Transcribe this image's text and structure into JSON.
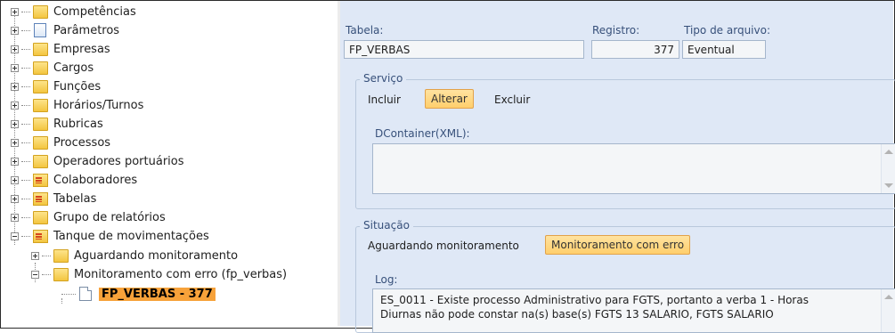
{
  "tree": {
    "items": [
      {
        "label": "Competências",
        "icon": "folder-icon",
        "expander": "plus"
      },
      {
        "label": "Parâmetros",
        "icon": "document-icon",
        "expander": "plus"
      },
      {
        "label": "Empresas",
        "icon": "folder-icon",
        "expander": "plus"
      },
      {
        "label": "Cargos",
        "icon": "folder-icon",
        "expander": "plus"
      },
      {
        "label": "Funções",
        "icon": "folder-icon",
        "expander": "plus"
      },
      {
        "label": "Horários/Turnos",
        "icon": "folder-icon",
        "expander": "plus"
      },
      {
        "label": "Rubricas",
        "icon": "folder-icon",
        "expander": "plus"
      },
      {
        "label": "Processos",
        "icon": "folder-icon",
        "expander": "plus"
      },
      {
        "label": "Operadores portuários",
        "icon": "folder-icon",
        "expander": "plus"
      },
      {
        "label": "Colaboradores",
        "icon": "folder-list-icon",
        "expander": "plus"
      },
      {
        "label": "Tabelas",
        "icon": "folder-list-icon",
        "expander": "plus"
      },
      {
        "label": "Grupo de relatórios",
        "icon": "folder-icon",
        "expander": "plus"
      },
      {
        "label": "Tanque de movimentações",
        "icon": "folder-list-icon",
        "expander": "minus"
      }
    ],
    "sub_items": [
      {
        "label": "Aguardando monitoramento",
        "icon": "folder-icon",
        "expander": "plus"
      },
      {
        "label": "Monitoramento com erro (fp_verbas)",
        "icon": "folder-icon",
        "expander": "minus"
      }
    ],
    "selected_item": {
      "label": "FP_VERBAS - 377",
      "icon": "document-icon"
    }
  },
  "form": {
    "tabela": {
      "label": "Tabela:",
      "value": "FP_VERBAS"
    },
    "registro": {
      "label": "Registro:",
      "value": "377"
    },
    "tipo_arquivo": {
      "label": "Tipo de arquivo:",
      "value": "Eventual"
    },
    "servico": {
      "title": "Serviço",
      "options": [
        {
          "label": "Incluir",
          "active": false
        },
        {
          "label": "Alterar",
          "active": true
        },
        {
          "label": "Excluir",
          "active": false
        }
      ],
      "dcontainer_label": "DContainer(XML):",
      "dcontainer_value": ""
    },
    "situacao": {
      "title": "Situação",
      "options": [
        {
          "label": "Aguardando monitoramento",
          "active": false
        },
        {
          "label": "Monitoramento com erro",
          "active": true
        }
      ],
      "log_label": "Log:",
      "log_lines": [
        "ES_0011 - Existe processo Administrativo para FGTS, portanto a verba 1 - Horas",
        "Diurnas não pode constar na(s) base(s) FGTS 13 SALARIO, FGTS SALARIO"
      ]
    }
  },
  "colors": {
    "pane_background": "#dfe8f6",
    "selection_highlight": "#f7a23a",
    "active_option": "#ffcf6c",
    "label_text": "#37507a"
  }
}
